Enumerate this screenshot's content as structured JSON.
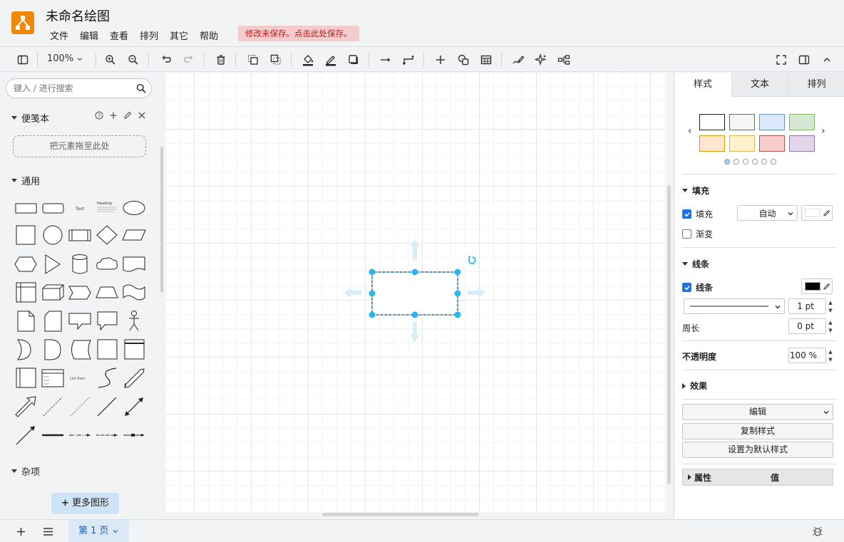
{
  "app": {
    "title": "未命名绘图",
    "unsaved_notice": "修改未保存。点击此处保存。",
    "menu": [
      "文件",
      "编辑",
      "查看",
      "排列",
      "其它",
      "帮助"
    ]
  },
  "toolbar": {
    "zoom": "100%",
    "icons": [
      "sidebar-toggle-icon",
      "zoom-in-icon",
      "zoom-out-icon",
      "undo-icon",
      "redo-icon",
      "delete-icon",
      "to-front-icon",
      "to-back-icon",
      "fill-color-icon",
      "line-color-icon",
      "shadow-icon",
      "connection-icon",
      "waypoints-icon",
      "insert-icon",
      "shapes-icon",
      "table-icon",
      "freehand-icon",
      "ai-sparkle-icon",
      "layout-icon",
      "fullscreen-icon",
      "format-panel-icon",
      "collapse-icon"
    ]
  },
  "sidebar": {
    "search_placeholder": "键入 / 进行搜索",
    "scratchpad": {
      "title": "便笺本",
      "drop_hint": "把元素拖至此处"
    },
    "general": {
      "title": "通用"
    },
    "misc": {
      "title": "杂项"
    },
    "more_shapes": "更多图形",
    "shape_texts": {
      "text": "Text",
      "heading": "Heading",
      "list_item": "List Item"
    }
  },
  "format_panel": {
    "tabs": [
      "样式",
      "文本",
      "排列"
    ],
    "swatches": [
      "#ffffff",
      "#f5f5f5",
      "#dae8fc",
      "#d5e8d4",
      "#ffe6cc",
      "#fff2cc",
      "#f8cecc",
      "#e1d5e7"
    ],
    "swatch_borders": [
      "#000000",
      "#666666",
      "#6c8ebf",
      "#82b366",
      "#d79b00",
      "#d6b656",
      "#b85450",
      "#9673a6"
    ],
    "fill_section": "填充",
    "fill": {
      "label": "填充",
      "checked": true,
      "mode": "自动",
      "color": "#ffffff"
    },
    "gradient": {
      "label": "渐变",
      "checked": false
    },
    "line_section": "线条",
    "line": {
      "label": "线条",
      "checked": true,
      "color": "#000000",
      "width": "1 pt"
    },
    "perimeter": {
      "label": "周长",
      "value": "0 pt"
    },
    "opacity": {
      "label": "不透明度",
      "value": "100 %"
    },
    "effects": "效果",
    "edit_button": "编辑",
    "copy_style": "复制样式",
    "set_default": "设置为默认样式",
    "property_header": "属性",
    "value_header": "值"
  },
  "footer": {
    "page_tab": "第 1 页"
  },
  "colors": {
    "brand": "#f08705",
    "selection": "#29b6f2",
    "unsaved_bg": "#f4cccc"
  }
}
